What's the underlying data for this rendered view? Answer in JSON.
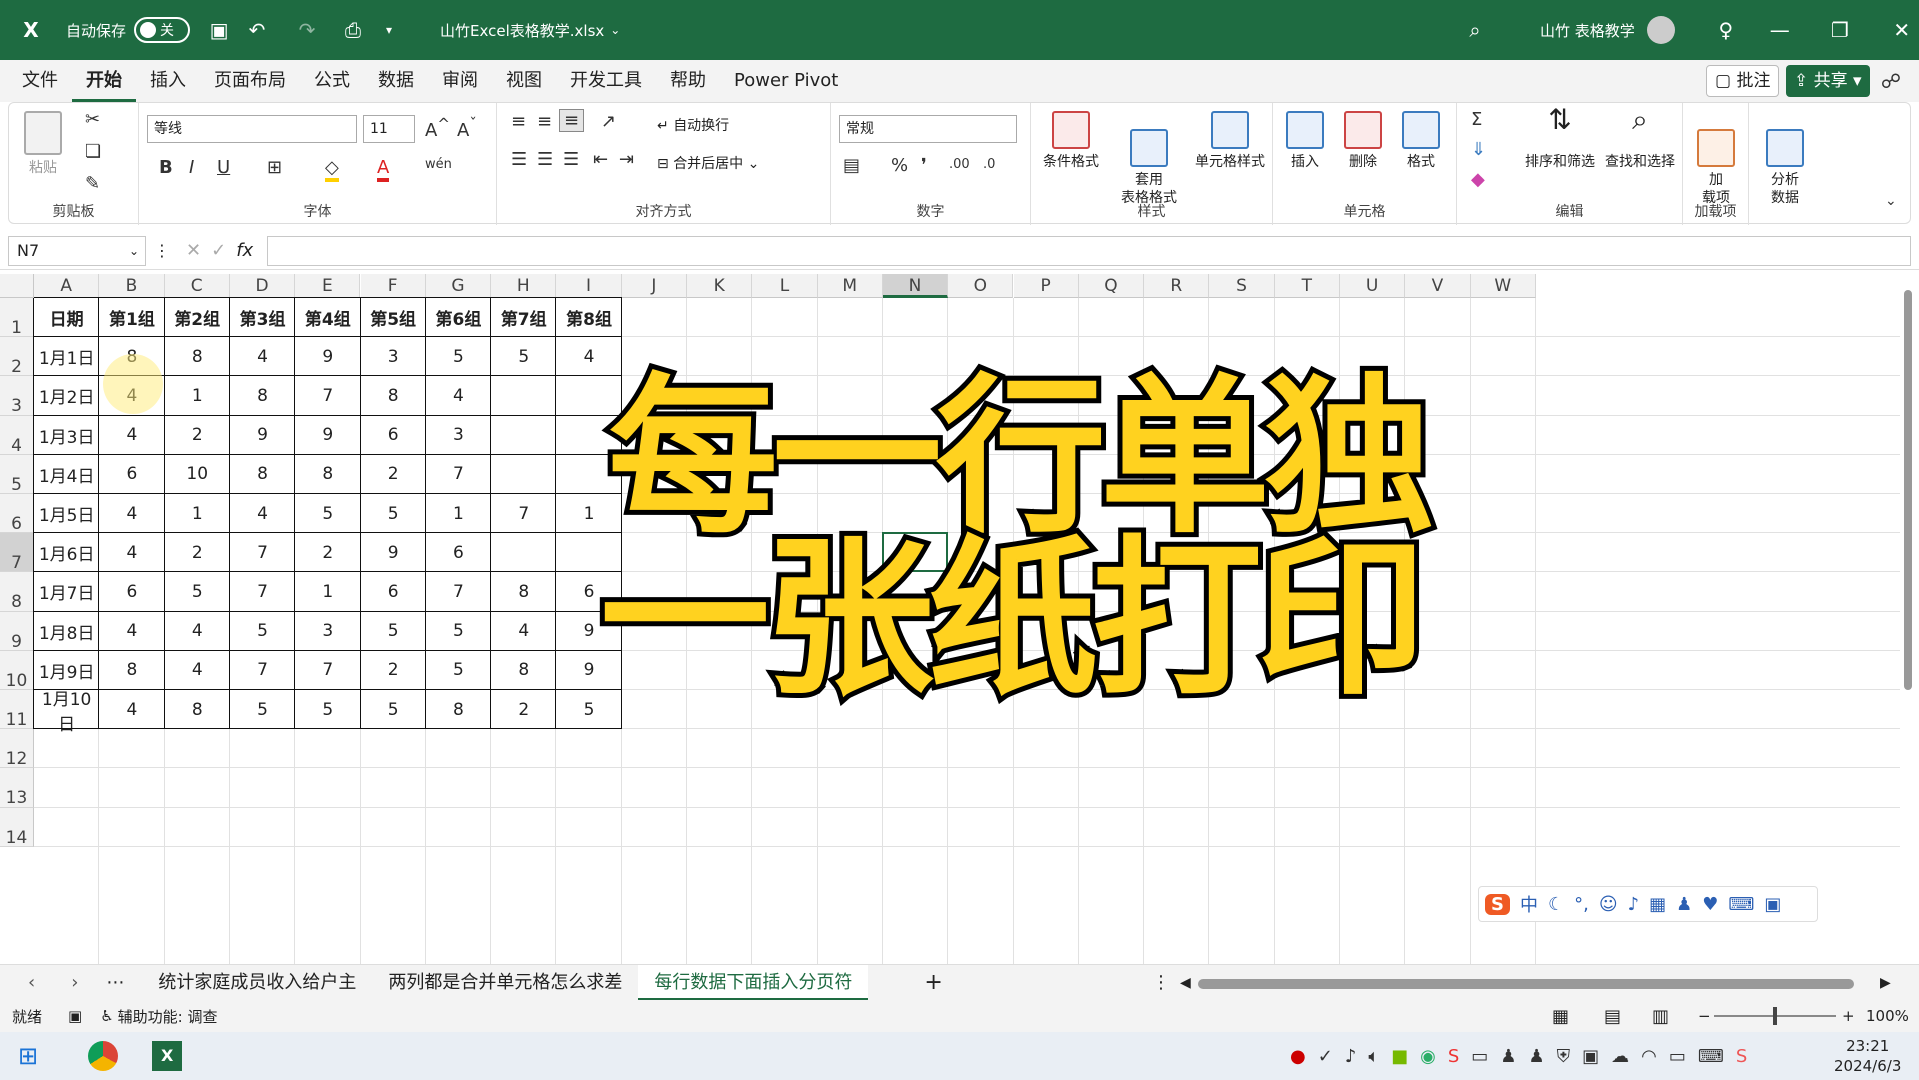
{
  "titlebar": {
    "autosave_label": "自动保存",
    "autosave_state": "关",
    "filename": "山竹Excel表格教学.xlsx",
    "user": "山竹 表格教学"
  },
  "menu": [
    "文件",
    "开始",
    "插入",
    "页面布局",
    "公式",
    "数据",
    "审阅",
    "视图",
    "开发工具",
    "帮助",
    "Power Pivot"
  ],
  "menu_right": {
    "comment": "批注",
    "share": "共享"
  },
  "ribbon": {
    "paste": "粘贴",
    "clipboard": "剪贴板",
    "font_name": "等线",
    "font_size": "11",
    "font_group": "字体",
    "wrap": "自动换行",
    "merge": "合并后居中",
    "align_group": "对齐方式",
    "number_format": "常规",
    "number_group": "数字",
    "cond_format": "条件格式",
    "table_format": "套用\n表格格式",
    "cell_style": "单元格样式",
    "styles_group": "样式",
    "insert": "插入",
    "delete": "删除",
    "format": "格式",
    "cells_group": "单元格",
    "sort": "排序和筛选",
    "find": "查找和选择",
    "edit_group": "编辑",
    "addins": "加\n载项",
    "addins_group": "加载项",
    "analyze": "分析\n数据"
  },
  "namebox": "N7",
  "columns": [
    "A",
    "B",
    "C",
    "D",
    "E",
    "F",
    "G",
    "H",
    "I",
    "J",
    "K",
    "L",
    "M",
    "N",
    "O",
    "P",
    "Q",
    "R",
    "S",
    "T",
    "U",
    "V",
    "W"
  ],
  "rows": [
    "1",
    "2",
    "3",
    "4",
    "5",
    "6",
    "7",
    "8",
    "9",
    "10",
    "11",
    "12",
    "13",
    "14"
  ],
  "table": {
    "header": [
      "日期",
      "第1组",
      "第2组",
      "第3组",
      "第4组",
      "第5组",
      "第6组",
      "第7组",
      "第8组"
    ],
    "rows": [
      [
        "1月1日",
        "8",
        "8",
        "4",
        "9",
        "3",
        "5",
        "5",
        "4"
      ],
      [
        "1月2日",
        "4",
        "1",
        "8",
        "7",
        "8",
        "4",
        "",
        ""
      ],
      [
        "1月3日",
        "4",
        "2",
        "9",
        "9",
        "6",
        "3",
        "",
        ""
      ],
      [
        "1月4日",
        "6",
        "10",
        "8",
        "8",
        "2",
        "7",
        "",
        ""
      ],
      [
        "1月5日",
        "4",
        "1",
        "4",
        "5",
        "5",
        "1",
        "7",
        "1"
      ],
      [
        "1月6日",
        "4",
        "2",
        "7",
        "2",
        "9",
        "6",
        "",
        ""
      ],
      [
        "1月7日",
        "6",
        "5",
        "7",
        "1",
        "6",
        "7",
        "8",
        "6"
      ],
      [
        "1月8日",
        "4",
        "4",
        "5",
        "3",
        "5",
        "5",
        "4",
        "9"
      ],
      [
        "1月9日",
        "8",
        "4",
        "7",
        "7",
        "2",
        "5",
        "8",
        "9"
      ],
      [
        "1月10日",
        "4",
        "8",
        "5",
        "5",
        "5",
        "8",
        "2",
        "5"
      ]
    ]
  },
  "overlay": {
    "line1": "每一行单独",
    "line2": "一张纸打印"
  },
  "sheets": [
    "统计家庭成员收入给户主",
    "两列都是合并单元格怎么求差",
    "每行数据下面插入分页符"
  ],
  "status": {
    "ready": "就绪",
    "accessibility": "辅助功能: 调查",
    "zoom": "100%"
  },
  "ime": {
    "mode": "中"
  },
  "clock": {
    "time": "23:21",
    "date": "2024/6/3"
  },
  "colors": {
    "excel_green": "#1e6b41",
    "overlay_yellow": "#ffd21f"
  }
}
